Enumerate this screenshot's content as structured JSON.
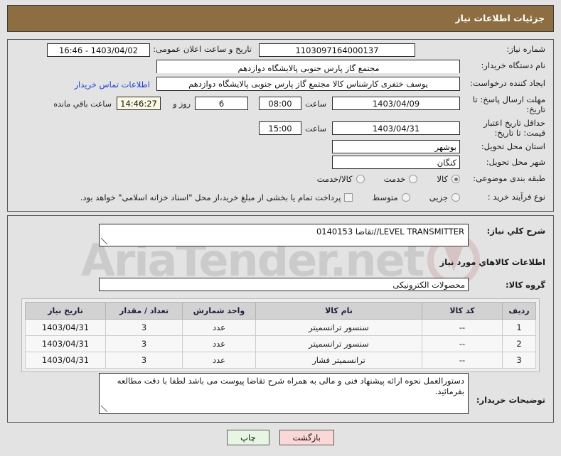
{
  "header": {
    "title": "جزئیات اطلاعات نیاز"
  },
  "watermark": {
    "text": "AriaTender.net"
  },
  "form": {
    "need_number": {
      "label": "شماره نیاز:",
      "value": "1103097164000137"
    },
    "announce_datetime": {
      "label": "تاریخ و ساعت اعلان عمومی:",
      "value": "1403/04/02 - 16:46"
    },
    "buyer_org": {
      "label": "نام دستگاه خریدار:",
      "value": "مجتمع گاز پارس جنوبی  پالایشگاه دوازدهم"
    },
    "request_creator": {
      "label": "ایجاد کننده درخواست:",
      "value": "یوسف ختفری کارشناس کالا مجتمع گاز پارس جنوبی  پالایشگاه دوازدهم"
    },
    "contact_link": {
      "label": "اطلاعات تماس خریدار"
    },
    "response_deadline": {
      "label": "مهلت ارسال پاسخ: تا تاریخ:",
      "date": "1403/04/09",
      "hour_label": "ساعت",
      "time": "08:00",
      "days": "6",
      "days_suffix": "روز و",
      "countdown": "14:46:27",
      "countdown_suffix": "ساعت باقي مانده"
    },
    "price_validity": {
      "label": "حداقل تاریخ اعتبار قیمت: تا تاریخ:",
      "date": "1403/04/31",
      "hour_label": "ساعت",
      "time": "15:00"
    },
    "delivery_province": {
      "label": "استان محل تحویل:",
      "value": "بوشهر"
    },
    "delivery_city": {
      "label": "شهر محل تحویل:",
      "value": "کنگان"
    },
    "category": {
      "label": "طبقه بندی موضوعی:",
      "options": [
        {
          "text": "کالا",
          "selected": true
        },
        {
          "text": "خدمت",
          "selected": false
        },
        {
          "text": "کالا/خدمت",
          "selected": false
        }
      ]
    },
    "purchase_type": {
      "label": "نوع فرآیند خرید :",
      "options": [
        {
          "text": "جزیی",
          "selected": false
        },
        {
          "text": "متوسط",
          "selected": false
        }
      ],
      "checkbox": {
        "text": "پرداخت تمام یا بخشی از مبلغ خرید،از محل \"اسناد خزانه اسلامی\" خواهد بود.",
        "checked": false
      }
    }
  },
  "need_summary": {
    "label": "شرح کلي نیاز:",
    "value": "LEVEL TRANSMITTER//تقاضا 0140153"
  },
  "goods_section": {
    "heading": "اطلاعات کالاهاي مورد نیاز",
    "group_label": "گروه کالا:",
    "group_value": "محصولات الکترونیکی"
  },
  "table": {
    "columns": [
      "ردیف",
      "کد کالا",
      "نام کالا",
      "واحد شمارش",
      "تعداد / مقدار",
      "تاریخ نیاز"
    ],
    "rows": [
      {
        "index": "1",
        "code": "--",
        "name": "سنسور ترانسمیتر",
        "unit": "عدد",
        "qty": "3",
        "date": "1403/04/31"
      },
      {
        "index": "2",
        "code": "--",
        "name": "سنسور ترانسمیتر",
        "unit": "عدد",
        "qty": "3",
        "date": "1403/04/31"
      },
      {
        "index": "3",
        "code": "--",
        "name": "ترانسمیتر فشار",
        "unit": "عدد",
        "qty": "3",
        "date": "1403/04/31"
      }
    ]
  },
  "buyer_notes": {
    "label": "توضیحات خریدار:",
    "value": "دستورالعمل نحوه ارائه پیشنهاد فنی و مالی به همراه شرح تقاضا پیوست می باشد لطفا با دقت  مطالعه بفرمائید."
  },
  "footer": {
    "print_label": "چاپ",
    "back_label": "بازگشت"
  },
  "colors": {
    "header_bg": "#8d6e42",
    "page_bg": "#e3e3e3",
    "link": "#1b3fd0",
    "table_header_bg": "#d2d2d2",
    "print_btn_bg": "#e7f6e3",
    "back_btn_bg": "#fbd8d8",
    "countdown_bg": "#fbf8e3"
  }
}
